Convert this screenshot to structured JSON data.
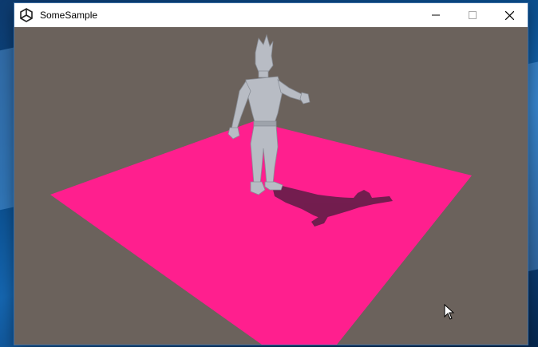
{
  "window": {
    "title": "SomeSample",
    "controls": [
      "minimize",
      "maximize",
      "close"
    ]
  },
  "icons": {
    "app": "unity-logo-icon",
    "minimize": "minimize-icon",
    "maximize": "maximize-icon",
    "close": "close-icon",
    "cursor": "mouse-pointer-icon"
  },
  "scene": {
    "background_color": "#6b625c",
    "plane_color": "#ff1f8e",
    "character_color": "#b8bcc4",
    "shadow_color": "#4a1a3a"
  },
  "desktop": {
    "accent": "#0a4d8c"
  }
}
